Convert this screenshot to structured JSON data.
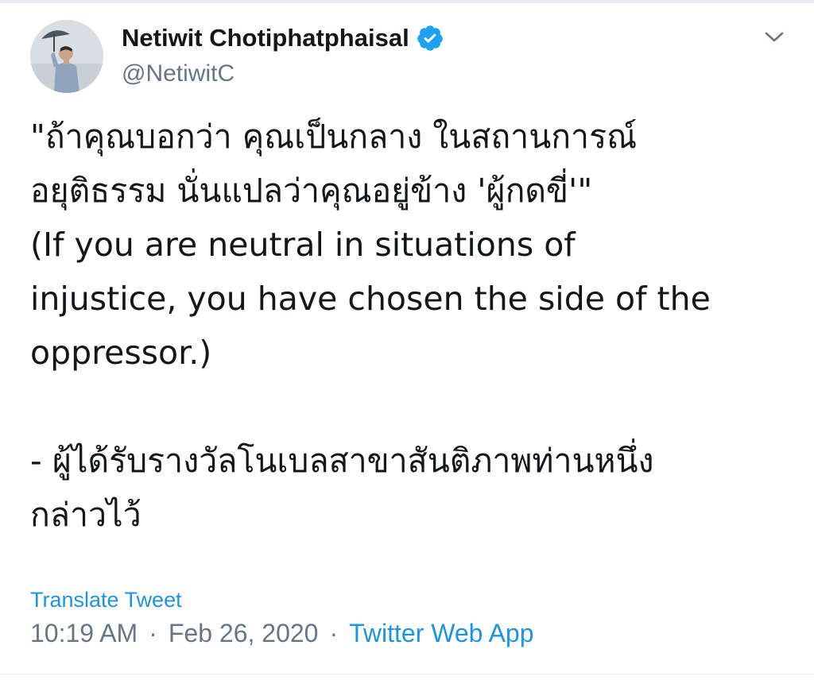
{
  "tweet": {
    "author": {
      "display_name": "Netiwit Chotiphatphaisal",
      "handle": "@NetiwitC",
      "verified": true
    },
    "body_lines": [
      "\"ถ้าคุณบอกว่า คุณเป็นกลาง ในสถานการณ์",
      "อยุติธรรม นั่นแปลว่าคุณอยู่ข้าง 'ผู้กดขี่'\"",
      "(If you are neutral in situations of",
      "injustice, you have chosen the side of the",
      "oppressor.)",
      "",
      "- ผู้ได้รับรางวัลโนเบลสาขาสันติภาพท่านหนึ่ง",
      "กล่าวไว้"
    ],
    "translate_label": "Translate Tweet",
    "time": "10:19 AM",
    "separator": "·",
    "date": "Feb 26, 2020",
    "source": "Twitter Web App"
  },
  "icons": {
    "verified": "verified-badge-icon",
    "caret": "chevron-down-icon",
    "avatar": "profile-avatar"
  },
  "colors": {
    "accent": "#1b95e0",
    "verified": "#1da1f2",
    "text": "#14171a",
    "muted": "#657786"
  }
}
